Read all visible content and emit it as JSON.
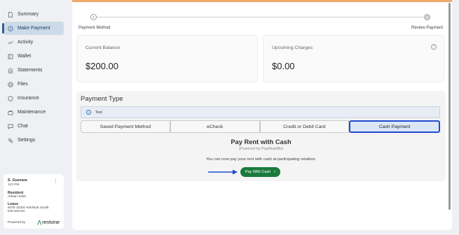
{
  "sidebar": {
    "items": [
      {
        "label": "Summary",
        "icon": "document-icon"
      },
      {
        "label": "Make Payment",
        "icon": "dollar-icon",
        "active": true
      },
      {
        "label": "Activity",
        "icon": "activity-icon"
      },
      {
        "label": "Wallet",
        "icon": "wallet-icon"
      },
      {
        "label": "Statements",
        "icon": "statements-icon"
      },
      {
        "label": "Files",
        "icon": "files-icon"
      },
      {
        "label": "Insurance",
        "icon": "shield-icon"
      },
      {
        "label": "Maintenance",
        "icon": "toolbox-icon"
      },
      {
        "label": "Chat",
        "icon": "chat-icon"
      },
      {
        "label": "Settings",
        "icon": "settings-icon"
      }
    ]
  },
  "user_card": {
    "name": "S. Guevara",
    "time": "123 PM",
    "resident_label": "Resident",
    "resident_name": "Adrian Soler",
    "lease_label": "Lease",
    "lease_line1": "6476 103rd AVENUE South",
    "lease_line2": "test test tes",
    "powered_by": "Powered by",
    "brand": "rentvine"
  },
  "stepper": {
    "step1_label": "Payment Method",
    "step2_label": "Review Payment",
    "step1_num": "1",
    "step2_num": "2"
  },
  "balances": {
    "current_title": "Current Balance",
    "current_value": "$200.00",
    "upcoming_title": "Upcoming Charges",
    "upcoming_value": "$0.00"
  },
  "payment": {
    "title": "Payment Type",
    "notice": "Test",
    "tabs": [
      {
        "label": "Saved Payment Method"
      },
      {
        "label": "eCheck"
      },
      {
        "label": "Credit or Debit Card"
      },
      {
        "label": "Cash Payment",
        "active": true
      }
    ],
    "cash_title": "Pay Rent with Cash",
    "cash_subtitle": "(Powered by PayNearMe)",
    "cash_desc": "You can now pay your rent with cash at participating retailers.",
    "cash_button": "Pay With Cash"
  },
  "colors": {
    "accent": "#1f4bd1",
    "active_nav_bg": "#cddbe8",
    "cash_button": "#1a7a3c",
    "top_border": "#f0a865"
  }
}
